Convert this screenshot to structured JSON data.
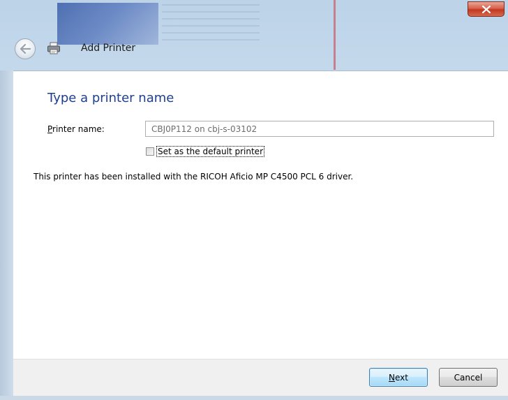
{
  "window": {
    "title": "Add Printer",
    "close_label": "X"
  },
  "icons": {
    "back": "back-arrow-icon",
    "printer": "printer-icon",
    "close": "close-icon"
  },
  "main": {
    "heading": "Type a printer name",
    "printer_name_label": "Printer name:",
    "printer_name_value": "CBJ0P112 on cbj-s-03102",
    "default_checkbox_label": "Set as the default printer",
    "default_checked": false,
    "info": "This printer has been installed with the RICOH Aficio MP C4500 PCL 6 driver."
  },
  "footer": {
    "next_label": "Next",
    "cancel_label": "Cancel"
  },
  "colors": {
    "heading": "#1e3f8f",
    "close_button": "#c1381f",
    "next_button_border": "#3c7fb1"
  }
}
